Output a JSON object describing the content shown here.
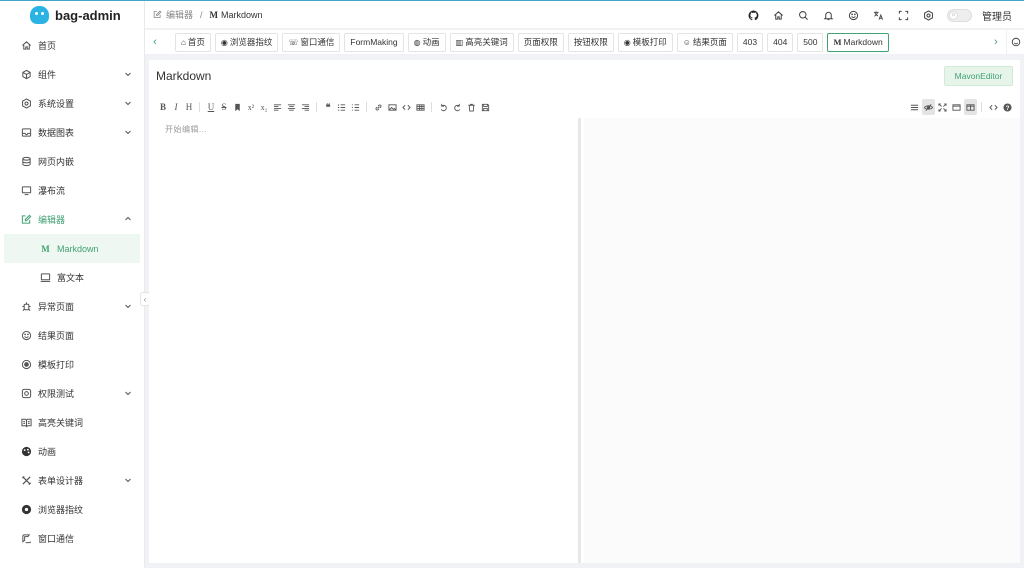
{
  "app": {
    "name": "bag-admin",
    "brand_color": "#41a272",
    "logo_color": "#2bb3e3"
  },
  "sidebar": {
    "items": [
      {
        "label": "首页",
        "icon": "home-icon",
        "has_children": false
      },
      {
        "label": "组件",
        "icon": "cube-icon",
        "has_children": true
      },
      {
        "label": "系统设置",
        "icon": "gear-icon",
        "has_children": true
      },
      {
        "label": "数据图表",
        "icon": "chart-icon",
        "has_children": true
      },
      {
        "label": "网页内嵌",
        "icon": "database-icon",
        "has_children": false
      },
      {
        "label": "瀑布流",
        "icon": "monitor-icon",
        "has_children": false
      },
      {
        "label": "编辑器",
        "icon": "edit-icon",
        "has_children": true,
        "expanded": true,
        "children": [
          {
            "label": "Markdown",
            "icon": "markdown-icon",
            "active": true
          },
          {
            "label": "富文本",
            "icon": "monitor-icon",
            "active": false
          }
        ]
      },
      {
        "label": "异常页面",
        "icon": "bug-icon",
        "has_children": true
      },
      {
        "label": "结果页面",
        "icon": "smile-icon",
        "has_children": false
      },
      {
        "label": "模板打印",
        "icon": "record-icon",
        "has_children": false
      },
      {
        "label": "权限测试",
        "icon": "lock-icon",
        "has_children": true
      },
      {
        "label": "高亮关键词",
        "icon": "book-icon",
        "has_children": false
      },
      {
        "label": "动画",
        "icon": "palette-icon",
        "has_children": false
      },
      {
        "label": "表单设计器",
        "icon": "tools-icon",
        "has_children": true
      },
      {
        "label": "浏览器指纹",
        "icon": "chrome-icon",
        "has_children": false
      },
      {
        "label": "窗口通信",
        "icon": "phone-icon",
        "has_children": false
      }
    ]
  },
  "header": {
    "breadcrumb": {
      "parent": "编辑器",
      "separator": "/",
      "current_prefix": "M",
      "current": "Markdown"
    },
    "icons": [
      "github-icon",
      "home-icon",
      "search-icon",
      "bell-icon",
      "smile-icon",
      "translate-icon",
      "fullscreen-icon",
      "gear-icon"
    ],
    "user": "管理员"
  },
  "tabs": [
    {
      "label": "首页",
      "icon": "⌂",
      "active": false
    },
    {
      "label": "浏览器指纹",
      "icon": "◉",
      "active": false
    },
    {
      "label": "窗口通信",
      "icon": "☏",
      "active": false
    },
    {
      "label": "FormMaking",
      "icon": "",
      "active": false
    },
    {
      "label": "动画",
      "icon": "◍",
      "active": false
    },
    {
      "label": "高亮关键词",
      "icon": "▥",
      "active": false
    },
    {
      "label": "页面权限",
      "icon": "",
      "active": false
    },
    {
      "label": "按钮权限",
      "icon": "",
      "active": false
    },
    {
      "label": "模板打印",
      "icon": "◉",
      "active": false
    },
    {
      "label": "结果页面",
      "icon": "☺",
      "active": false
    },
    {
      "label": "403",
      "icon": "",
      "active": false
    },
    {
      "label": "404",
      "icon": "",
      "active": false
    },
    {
      "label": "500",
      "icon": "",
      "active": false
    },
    {
      "label": "Markdown",
      "icon": "M",
      "active": true
    }
  ],
  "main": {
    "title": "Markdown",
    "editor_button": "MavonEditor",
    "placeholder": "开始编辑...",
    "toolbar_left": [
      "B",
      "I",
      "H",
      "|",
      "U",
      "S",
      "bookmark",
      "x²",
      "x₂",
      "align-left",
      "align-center",
      "align-right",
      "|",
      "❝",
      "ol",
      "ul",
      "|",
      "link",
      "image",
      "code",
      "table",
      "|",
      "undo",
      "redo",
      "trash",
      "save"
    ],
    "toolbar_right": [
      "menu",
      "eye",
      "expand",
      "window",
      "split",
      "|",
      "source",
      "help"
    ]
  }
}
